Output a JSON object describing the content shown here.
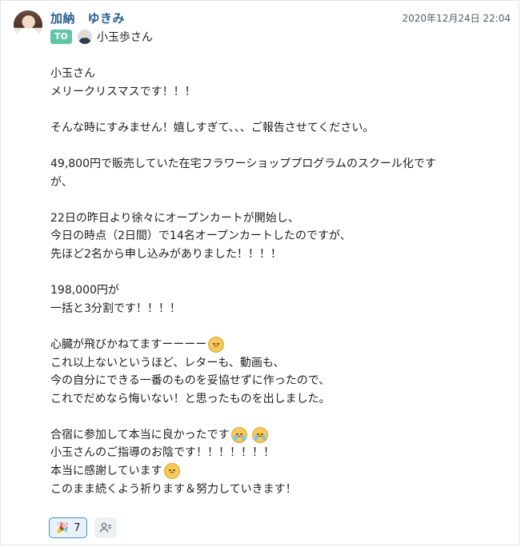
{
  "message": {
    "sender_name": "加納　ゆきみ",
    "timestamp": "2020年12月24日 22:04",
    "to_label": "TO",
    "to_name": "小玉歩さん",
    "lines": [
      "小玉さん",
      "メリークリスマスです！！！",
      "",
      "そんな時にすみません！嬉しすぎて、、、ご報告させてください。",
      "",
      "49,800円で販売していた在宅フラワーショッププログラムのスクール化です",
      "が、",
      "",
      "22日の昨日より徐々にオープンカートが開始し、",
      "今日の時点（2日間）で14名オープンカートしたのですが、",
      "先ほど2名から申し込みがありました！！！！",
      "",
      "198,000円が",
      "一括と3分割です！！！！",
      "",
      "心臓が飛びかねてますーーーー",
      "これ以上ないというほど、レターも、動画も、",
      "今の自分にできる一番のものを妥協せずに作ったので、",
      "これでだめなら悔いない！と思ったものを出しました。",
      "",
      "合宿に参加して本当に良かったです",
      "小玉さんのご指導のお陰です！！！！！！！",
      "本当に感謝しています",
      "このまま続くよう祈ります＆努力していきます！"
    ]
  },
  "icons": {
    "sender_avatar": "avatar-photo",
    "to_avatar": "avatar-photo",
    "emoji_worried": "worried-face-icon",
    "emoji_crying": "loudly-crying-face-icon",
    "reaction": "party-popper-icon",
    "add_reaction": "add-reaction-icon"
  },
  "reactions": {
    "party_count": "7",
    "party_glyph": "🎉"
  },
  "colors": {
    "sender_name": "#2b5f8e",
    "to_badge": "#5ec5a8",
    "reaction_border": "#4a90c8"
  }
}
